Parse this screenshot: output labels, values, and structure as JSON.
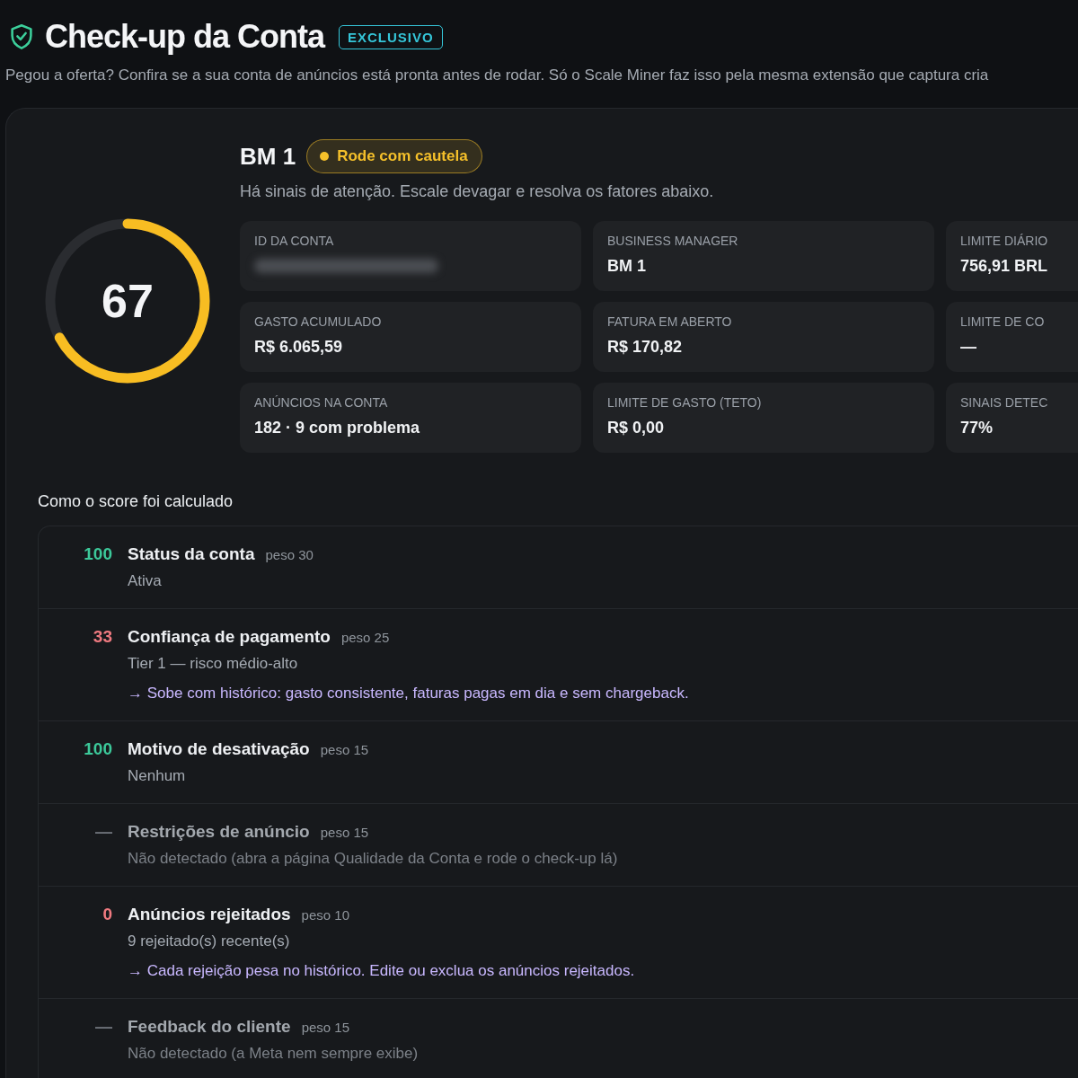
{
  "header": {
    "title": "Check-up da Conta",
    "badge": "EXCLUSIVO",
    "subtitle": "Pegou a oferta? Confira se a sua conta de anúncios está pronta antes de rodar. Só o Scale Miner faz isso pela mesma extensão que captura cria"
  },
  "account": {
    "name": "BM 1",
    "status": {
      "label": "Rode com cautela",
      "kind": "warning"
    },
    "message": "Há sinais de atenção. Escale devagar e resolva os fatores abaixo.",
    "score": "67",
    "level": 0.67,
    "fields": [
      {
        "label": "ID DA CONTA",
        "redacted": true
      },
      {
        "label": "BUSINESS MANAGER",
        "value": "BM 1"
      },
      {
        "label": "LIMITE DIÁRIO",
        "value": "756,91 BRL"
      },
      {
        "label": "GASTO ACUMULADO",
        "value": "R$ 6.065,59"
      },
      {
        "label": "FATURA EM ABERTO",
        "value": "R$ 170,82"
      },
      {
        "label": "LIMITE DE CO",
        "value": "—"
      },
      {
        "label": "ANÚNCIOS NA CONTA",
        "value": "182 · 9 com problema"
      },
      {
        "label": "LIMITE DE GASTO (TETO)",
        "value": "R$ 0,00"
      },
      {
        "label": "SINAIS DETEC",
        "value": "77%"
      }
    ]
  },
  "breakdown": {
    "title": "Como o score foi calculado",
    "factors": [
      {
        "score": "100",
        "kind": "good",
        "name": "Status da conta",
        "weight": "peso 30",
        "detail": "Ativa"
      },
      {
        "score": "33",
        "kind": "bad",
        "name": "Confiança de pagamento",
        "weight": "peso 25",
        "detail": "Tier 1 — risco médio-alto",
        "tip": "→ Sobe com histórico: gasto consistente, faturas pagas em dia e sem chargeback."
      },
      {
        "score": "100",
        "kind": "good",
        "name": "Motivo de desativação",
        "weight": "peso 15",
        "detail": "Nenhum"
      },
      {
        "score": "—",
        "kind": "unknown",
        "name": "Restrições de anúncio",
        "weight": "peso 15",
        "detail": "Não detectado (abra a página Qualidade da Conta e rode o check-up lá)"
      },
      {
        "score": "0",
        "kind": "bad",
        "name": "Anúncios rejeitados",
        "weight": "peso 10",
        "detail": "9 rejeitado(s) recente(s)",
        "tip": "→ Cada rejeição pesa no histórico. Edite ou exclua os anúncios rejeitados."
      },
      {
        "score": "—",
        "kind": "unknown",
        "name": "Feedback do cliente",
        "weight": "peso 15",
        "detail": "Não detectado (a Meta nem sempre exibe)"
      }
    ]
  }
}
